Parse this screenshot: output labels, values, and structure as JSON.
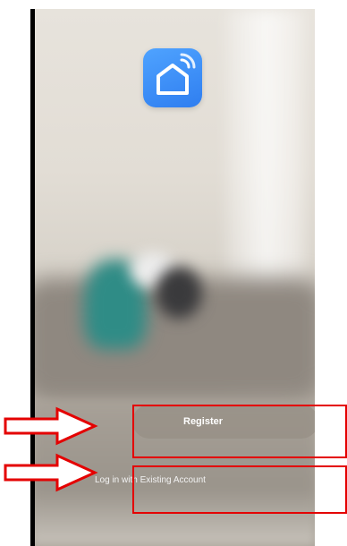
{
  "app": {
    "icon_name": "smart-home-icon",
    "icon_color": "#3d8ef8"
  },
  "actions": {
    "register_label": "Register",
    "login_label": "Log in with Existing Account"
  },
  "annotations": {
    "highlight_color": "#e40000",
    "arrow_icon": "right-arrow-outline"
  }
}
